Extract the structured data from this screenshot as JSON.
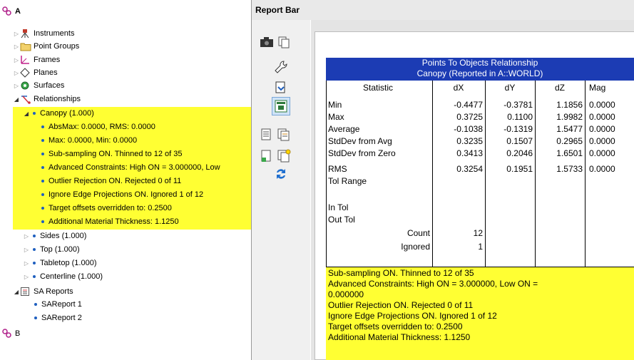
{
  "tree": {
    "root_a": "A",
    "instruments": "Instruments",
    "point_groups": "Point Groups",
    "frames": "Frames",
    "planes": "Planes",
    "surfaces": "Surfaces",
    "relationships": "Relationships",
    "canopy": "Canopy (1.000)",
    "canopy_details": [
      "AbsMax: 0.0000, RMS: 0.0000",
      "Max: 0.0000, Min: 0.0000",
      "Sub-sampling ON. Thinned to 12 of 35",
      "Advanced Constraints: High ON = 3.000000, Low",
      "Outlier Rejection ON. Rejected 0 of 11",
      "Ignore Edge Projections ON. Ignored 1 of 12",
      "Target offsets overridden to: 0.2500",
      "Additional Material Thickness: 1.1250"
    ],
    "sides": "Sides (1.000)",
    "top": "Top (1.000)",
    "tabletop": "Tabletop (1.000)",
    "centerline": "Centerline (1.000)",
    "sa_reports": "SA Reports",
    "sareport1": "SAReport 1",
    "sareport2": "SAReport 2",
    "root_b": "B"
  },
  "report_bar": {
    "title": "Report Bar"
  },
  "report": {
    "title_line1": "Points To Objects Relationship",
    "title_line2": "Canopy (Reported in A::WORLD)",
    "headers": [
      "Statistic",
      "dX",
      "dY",
      "dZ",
      "Mag"
    ],
    "rows": [
      {
        "label": "Min",
        "dx": "-0.4477",
        "dy": "-0.3781",
        "dz": "1.1856",
        "mag": "0.0000"
      },
      {
        "label": "Max",
        "dx": "0.3725",
        "dy": "0.1100",
        "dz": "1.9982",
        "mag": "0.0000"
      },
      {
        "label": "Average",
        "dx": "-0.1038",
        "dy": "-0.1319",
        "dz": "1.5477",
        "mag": "0.0000"
      },
      {
        "label": "StdDev from Avg",
        "dx": "0.3235",
        "dy": "0.1507",
        "dz": "0.2965",
        "mag": "0.0000"
      },
      {
        "label": "StdDev from Zero",
        "dx": "0.3413",
        "dy": "0.2046",
        "dz": "1.6501",
        "mag": "0.0000"
      },
      {
        "label": "RMS",
        "dx": "0.3254",
        "dy": "0.1951",
        "dz": "1.5733",
        "mag": "0.0000"
      }
    ],
    "tol_range": "Tol Range",
    "in_tol": "In Tol",
    "out_tol": "Out Tol",
    "count_label": "Count",
    "count_value": "12",
    "ignored_label": "Ignored",
    "ignored_value": "1",
    "notes": [
      "Sub-sampling ON. Thinned to 12 of 35",
      "Advanced Constraints: High ON = 3.000000, Low ON =",
      "0.000000",
      "Outlier Rejection ON. Rejected 0 of 11",
      "Ignore Edge Projections ON. Ignored 1 of 12",
      "Target offsets overridden to: 0.2500",
      "Additional Material Thickness: 1.1250"
    ]
  },
  "colors": {
    "highlight": "#ffff33",
    "report_header": "#1c3cb4"
  }
}
